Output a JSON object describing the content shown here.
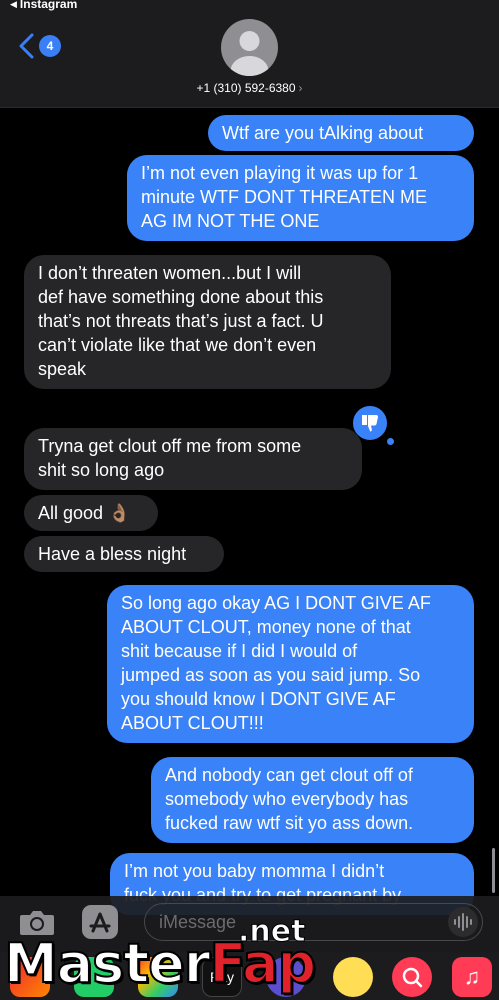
{
  "status_bar": {
    "back_app": "Instagram"
  },
  "header": {
    "back_badge": "4",
    "contact": "+1 (310) 592-6380",
    "contact_chevron": "›"
  },
  "messages": [
    {
      "from": "me",
      "text": "Wtf are you tAlking about"
    },
    {
      "from": "me",
      "text": "I’m not even playing it was up for 1\nminute WTF DONT THREATEN ME\nAG IM NOT THE ONE"
    },
    {
      "from": "them",
      "text": "I don’t threaten women...but I will\ndef have something done about this\nthat’s not threats that’s just a fact. U\ncan’t violate like that we don’t even\nspeak"
    },
    {
      "from": "them",
      "text": "Tryna get clout off me from some\nshit so long ago",
      "reaction": "thumbs-down"
    },
    {
      "from": "them",
      "text": "All good 👌🏽"
    },
    {
      "from": "them",
      "text": "Have a bless night"
    },
    {
      "from": "me",
      "text": "So long ago okay AG I DONT GIVE AF\nABOUT CLOUT, money none of that\nshit because if I did I would of\njumped as soon as you said jump. So\nyou should know I DONT GIVE AF\nABOUT CLOUT!!!"
    },
    {
      "from": "me",
      "text": "And nobody can get clout off of\nsomebody who everybody has\nfucked raw wtf sit yo ass down."
    },
    {
      "from": "me",
      "text": "I’m not you baby momma I didn’t\nfuck you and try to get pregnant by"
    }
  ],
  "input": {
    "placeholder": "iMessage"
  },
  "app_strip": {
    "apple_pay_label": "Pay"
  },
  "watermark": {
    "part1": "Master",
    "part2": "Fap",
    "suffix": ".net"
  },
  "colors": {
    "sent": "#3a82f7",
    "received": "#262628",
    "background": "#000000",
    "header": "#1c1c1e"
  }
}
